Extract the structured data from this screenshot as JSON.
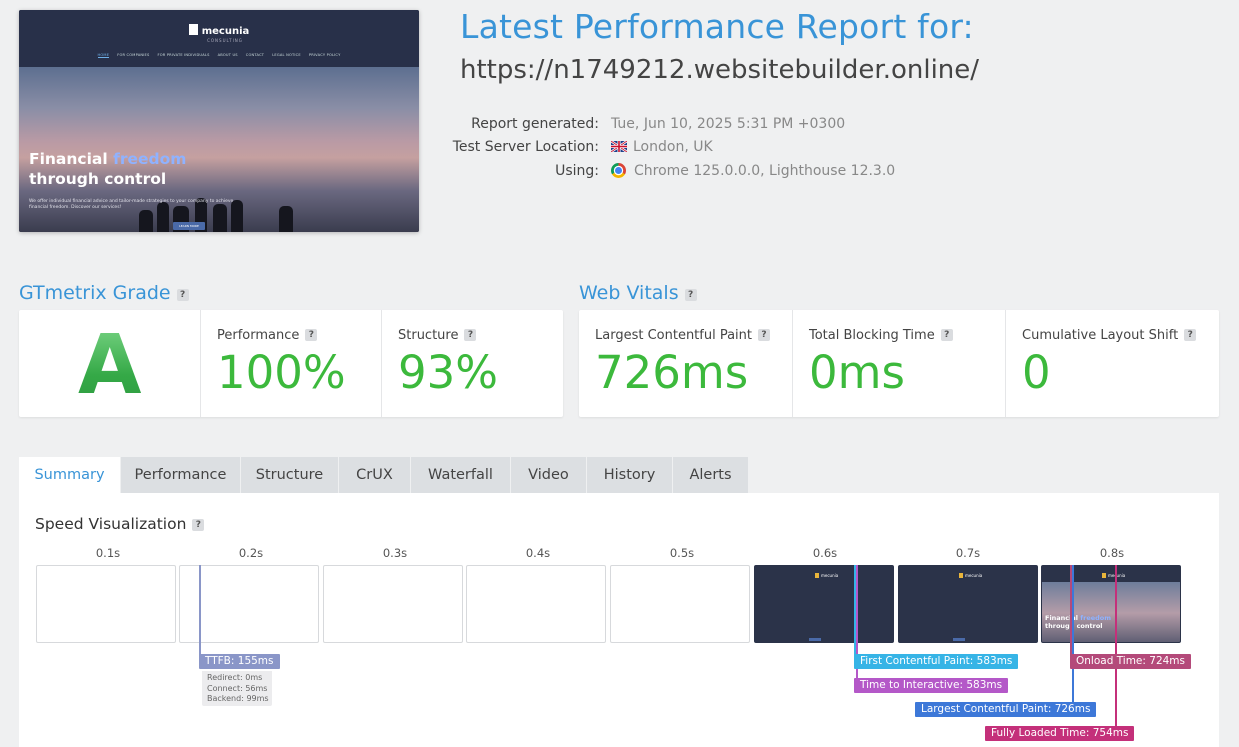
{
  "thumbnail": {
    "logo_text": "mecunia",
    "logo_sub": "CONSULTING",
    "menu": [
      "HOME",
      "FOR COMPANIES",
      "FOR PRIVATE INDIVIDUALS",
      "ABOUT US",
      "CONTACT",
      "LEGAL NOTICE",
      "PRIVACY POLICY"
    ],
    "headline_1a": "Financial",
    "headline_1b": "freedom",
    "headline_2": "through control",
    "description": "We offer individual financial advice and tailor-made strategies to your company to achieve financial freedom. Discover our services!",
    "button": "LEARN MORE"
  },
  "header": {
    "title": "Latest Performance Report for:",
    "url": "https://n1749212.websitebuilder.online/",
    "report_generated_label": "Report generated:",
    "report_generated_value": "Tue, Jun 10, 2025 5:31 PM +0300",
    "location_label": "Test Server Location:",
    "location_value": "London, UK",
    "using_label": "Using:",
    "using_value": "Chrome 125.0.0.0, Lighthouse 12.3.0"
  },
  "grade": {
    "heading": "GTmetrix Grade",
    "letter": "A",
    "performance_label": "Performance",
    "performance_value": "100%",
    "structure_label": "Structure",
    "structure_value": "93%"
  },
  "vitals": {
    "heading": "Web Vitals",
    "lcp_label": "Largest Contentful Paint",
    "lcp_value": "726ms",
    "tbt_label": "Total Blocking Time",
    "tbt_value": "0ms",
    "cls_label": "Cumulative Layout Shift",
    "cls_value": "0"
  },
  "tabs": [
    "Summary",
    "Performance",
    "Structure",
    "CrUX",
    "Waterfall",
    "Video",
    "History",
    "Alerts"
  ],
  "speed": {
    "title": "Speed Visualization",
    "ticks": [
      "0.1s",
      "0.2s",
      "0.3s",
      "0.4s",
      "0.5s",
      "0.6s",
      "0.7s",
      "0.8s"
    ],
    "frame_logo": "mecunia",
    "frame_headline_a": "Financial",
    "frame_headline_b": "freedom",
    "frame_headline_2": "through control",
    "ttfb_label": "TTFB: 155ms",
    "ttfb_redirect": "Redirect: 0ms",
    "ttfb_connect": "Connect: 56ms",
    "ttfb_backend": "Backend: 99ms",
    "fcp_label": "First Contentful Paint: 583ms",
    "tti_label": "Time to Interactive: 583ms",
    "lcp_label": "Largest Contentful Paint: 726ms",
    "onload_label": "Onload Time: 724ms",
    "fully_loaded_label": "Fully Loaded Time: 754ms"
  },
  "colors": {
    "accent": "#3994d7",
    "grade_green": "#3cb93c",
    "ttfb": "#8a96c8",
    "fcp": "#36b4e6",
    "tti": "#b458c8",
    "lcp": "#3d78d8",
    "onload": "#b44a7a",
    "fully_loaded": "#c4307a"
  }
}
